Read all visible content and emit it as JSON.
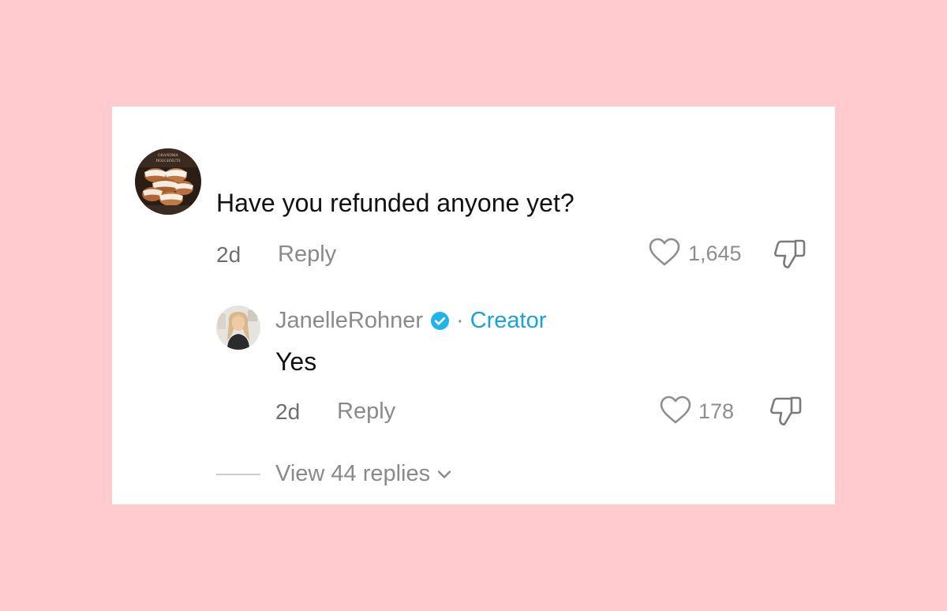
{
  "comment": {
    "text": "Have you refunded anyone yet?",
    "time": "2d",
    "reply_label": "Reply",
    "like_count": "1,645",
    "avatar_text_line1": "GRANDMA",
    "avatar_text_line2": "DOUGHNUTS"
  },
  "reply": {
    "username": "JanelleRohner",
    "separator": "·",
    "creator_label": "Creator",
    "text": "Yes",
    "time": "2d",
    "reply_label": "Reply",
    "like_count": "178"
  },
  "view_replies": {
    "label": "View 44 replies"
  },
  "colors": {
    "background": "#ffcbcf",
    "card": "#ffffff",
    "creator_accent": "#1aa3d6",
    "verified_badge": "#20b4e8",
    "muted_text": "#8a8a8a"
  },
  "icons": {
    "like": "heart-outline-icon",
    "dislike": "thumbs-down-icon",
    "verified": "verified-badge-icon",
    "expand": "chevron-down-icon"
  }
}
